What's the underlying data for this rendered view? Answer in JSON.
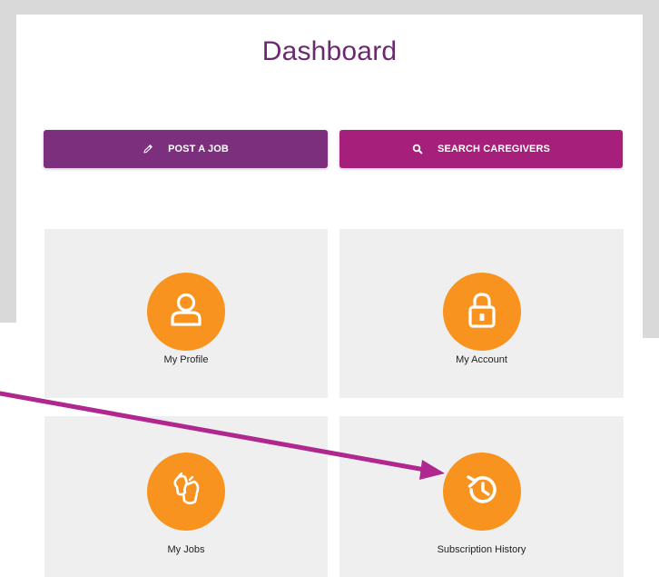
{
  "page": {
    "title": "Dashboard"
  },
  "actions": {
    "post_job": {
      "label": "POST A JOB",
      "icon": "pencil-icon",
      "color": "#7b2f7d"
    },
    "search_caregivers": {
      "label": "SEARCH CAREGIVERS",
      "icon": "search-icon",
      "color": "#a61f7b"
    }
  },
  "tiles": [
    {
      "label": "My Profile",
      "icon": "user-icon"
    },
    {
      "label": "My Account",
      "icon": "lock-icon"
    },
    {
      "label": "My Jobs",
      "icon": "jobs-icon"
    },
    {
      "label": "Subscription History",
      "icon": "history-icon"
    }
  ],
  "annotation": {
    "arrow_color": "#b0278f",
    "points_to": "Subscription History"
  },
  "colors": {
    "icon_circle": "#f7931e",
    "tile_bg": "#efefef",
    "title": "#6b2a6e"
  }
}
